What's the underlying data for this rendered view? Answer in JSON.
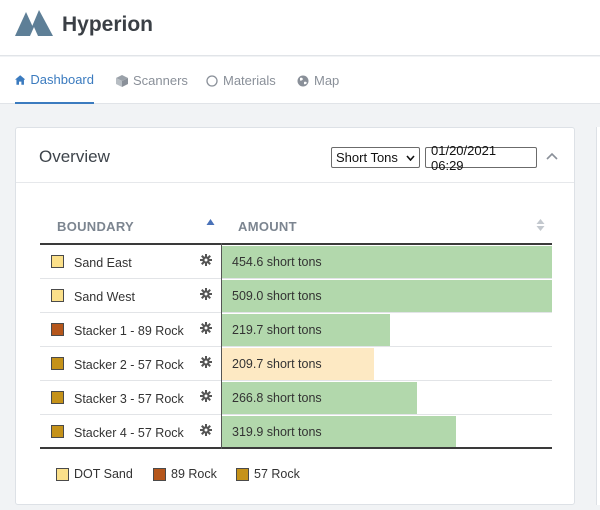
{
  "app": {
    "title": "Hyperion"
  },
  "nav": {
    "tabs": [
      {
        "label": "Dashboard",
        "icon": "home-icon",
        "active": true
      },
      {
        "label": "Scanners",
        "icon": "cube-icon",
        "active": false
      },
      {
        "label": "Materials",
        "icon": "circle-icon",
        "active": false
      },
      {
        "label": "Map",
        "icon": "globe-icon",
        "active": false
      }
    ]
  },
  "overview": {
    "title": "Overview",
    "unit_select": "Short Tons",
    "datetime": "01/20/2021 06:29"
  },
  "colors": {
    "accent": "#3b7bbf",
    "bar_green": "#b2d8ac",
    "bar_orange": "#fde9c3",
    "dot_sand": "#fbe08a",
    "rock_89": "#b5561b",
    "rock_57": "#c59219"
  },
  "table": {
    "headers": {
      "boundary": "BOUNDARY",
      "amount": "AMOUNT"
    },
    "max_amount": 509.0,
    "rows": [
      {
        "name": "Sand East",
        "amount": 454.6,
        "amount_label": "454.6 short tons",
        "swatch": "#fbe08a",
        "bar": "#b2d8ac",
        "bar_fraction": 1.0
      },
      {
        "name": "Sand West",
        "amount": 509.0,
        "amount_label": "509.0 short tons",
        "swatch": "#fbe08a",
        "bar": "#b2d8ac",
        "bar_fraction": 1.0
      },
      {
        "name": "Stacker 1 - 89 Rock",
        "amount": 219.7,
        "amount_label": "219.7 short tons",
        "swatch": "#b5561b",
        "bar": "#b2d8ac",
        "bar_fraction": 0.51
      },
      {
        "name": "Stacker 2 - 57 Rock",
        "amount": 209.7,
        "amount_label": "209.7 short tons",
        "swatch": "#c59219",
        "bar": "#fde9c3",
        "bar_fraction": 0.46
      },
      {
        "name": "Stacker 3 - 57 Rock",
        "amount": 266.8,
        "amount_label": "266.8 short tons",
        "swatch": "#c59219",
        "bar": "#b2d8ac",
        "bar_fraction": 0.59
      },
      {
        "name": "Stacker 4 - 57 Rock",
        "amount": 319.9,
        "amount_label": "319.9 short tons",
        "swatch": "#c59219",
        "bar": "#b2d8ac",
        "bar_fraction": 0.71
      }
    ]
  },
  "legend": [
    {
      "label": "DOT Sand",
      "color": "#fbe08a"
    },
    {
      "label": "89 Rock",
      "color": "#b5561b"
    },
    {
      "label": "57 Rock",
      "color": "#c59219"
    }
  ]
}
